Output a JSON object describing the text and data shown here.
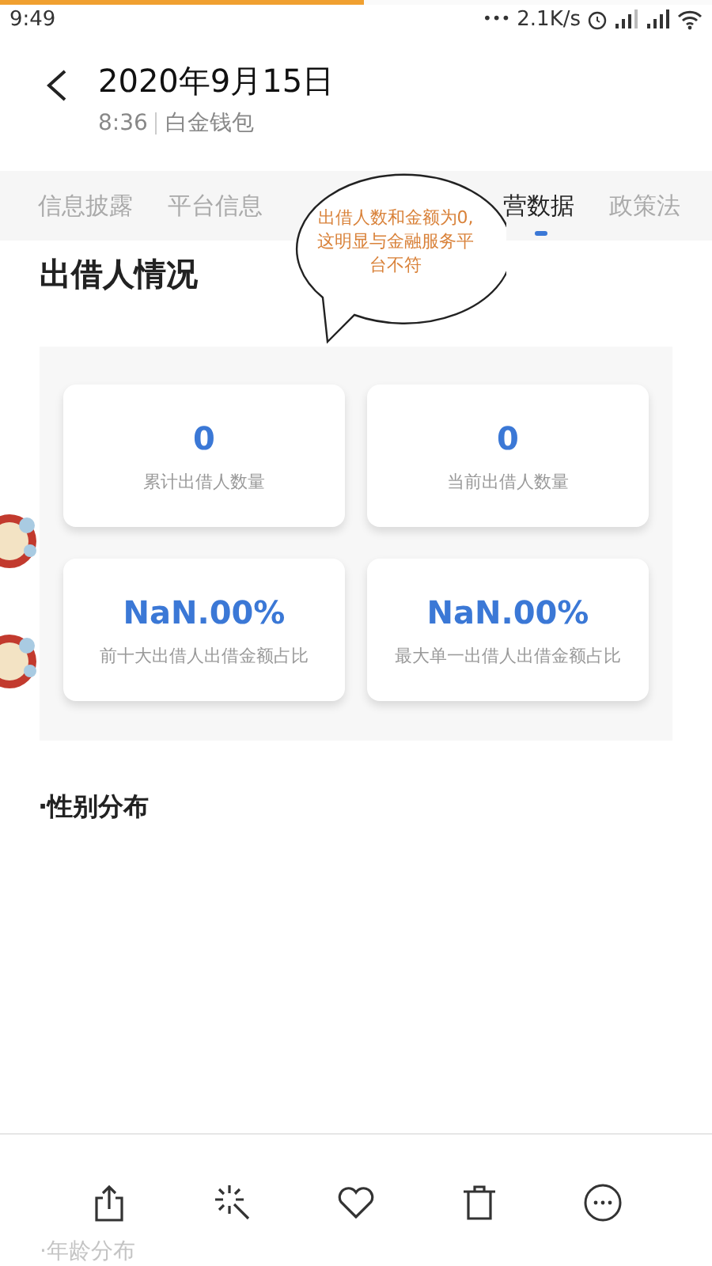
{
  "load_progress": {
    "level": 0.51
  },
  "status_bar": {
    "time": "9:49",
    "dots": "•••",
    "network_speed": "2.1K/s"
  },
  "header": {
    "title": "2020年9月15日",
    "time": "8:36",
    "source": "白金钱包"
  },
  "tabs": [
    {
      "label": "信息披露",
      "selected": false
    },
    {
      "label": "平台信息",
      "selected": false
    },
    {
      "label": "营数据",
      "selected": true
    },
    {
      "label": "政策法",
      "selected": false
    }
  ],
  "section_title": "出借人情况",
  "stats": [
    {
      "value": "0",
      "label": "累计出借人数量"
    },
    {
      "value": "0",
      "label": "当前出借人数量"
    },
    {
      "value": "NaN.00%",
      "label": "前十大出借人出借金额占比"
    },
    {
      "value": "NaN.00%",
      "label": "最大单一出借人出借金额占比"
    }
  ],
  "subsection_title": "·性别分布",
  "annotation": {
    "text": "出借人数和金额为0,这明显与金融服务平台不符"
  },
  "next_section_title": "·年龄分布"
}
